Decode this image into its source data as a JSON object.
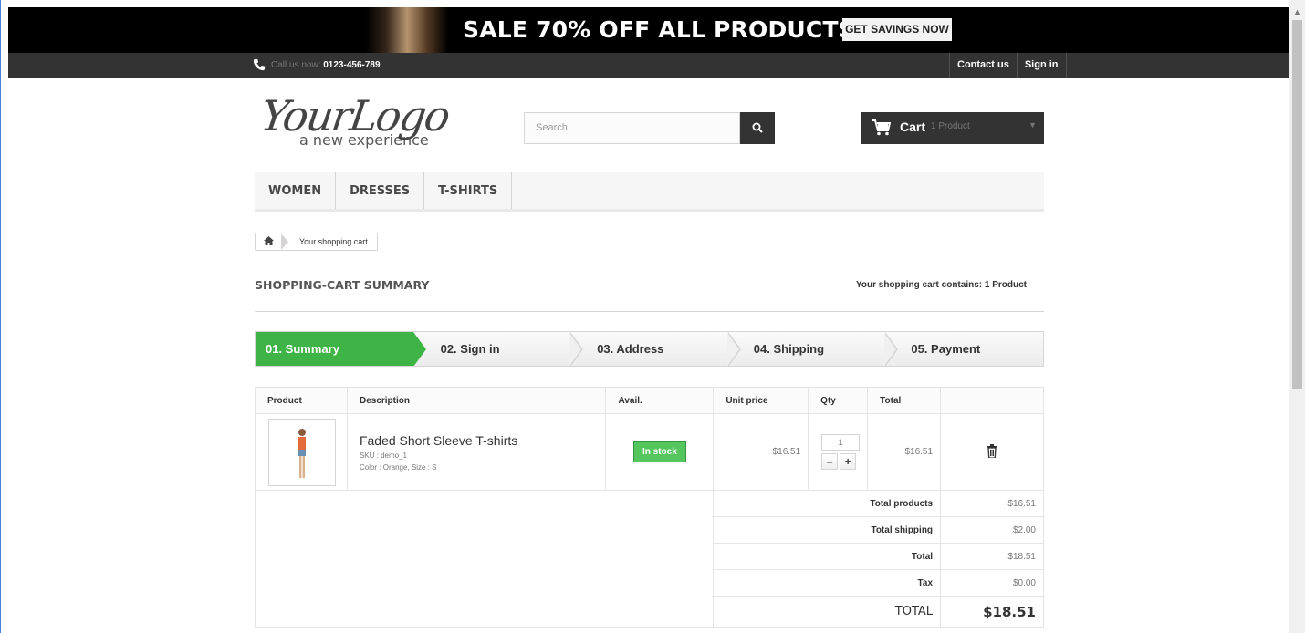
{
  "banner": {
    "headline": "SALE 70% OFF ALL PRODUCTS",
    "cta": "GET SAVINGS NOW"
  },
  "topbar": {
    "call_label": "Call us now:",
    "phone": "0123-456-789",
    "contact": "Contact us",
    "signin": "Sign in"
  },
  "logo": {
    "line1": "YourLogo",
    "line2": "a new experience"
  },
  "search": {
    "placeholder": "Search"
  },
  "cart_block": {
    "label": "Cart",
    "count": "1 Product"
  },
  "menu": [
    "WOMEN",
    "DRESSES",
    "T-SHIRTS"
  ],
  "breadcrumb": {
    "current": "Your shopping cart"
  },
  "page": {
    "title": "SHOPPING-CART SUMMARY",
    "contains": "Your shopping cart contains: 1 Product"
  },
  "steps": [
    "01. Summary",
    "02. Sign in",
    "03. Address",
    "04. Shipping",
    "05. Payment"
  ],
  "table": {
    "headers": [
      "Product",
      "Description",
      "Avail.",
      "Unit price",
      "Qty",
      "Total"
    ],
    "item": {
      "name": "Faded Short Sleeve T-shirts",
      "sku": "SKU : demo_1",
      "attrs": "Color : Orange, Size : S",
      "avail": "In stock",
      "unit_price": "$16.51",
      "qty": "1",
      "total": "$16.51"
    },
    "totals": [
      {
        "label": "Total products",
        "value": "$16.51"
      },
      {
        "label": "Total shipping",
        "value": "$2.00"
      },
      {
        "label": "Total",
        "value": "$18.51"
      },
      {
        "label": "Tax",
        "value": "$0.00"
      }
    ],
    "grand": {
      "label": "TOTAL",
      "value": "$18.51"
    }
  },
  "colors": {
    "accent_green": "#3fb446",
    "dark": "#333333"
  }
}
